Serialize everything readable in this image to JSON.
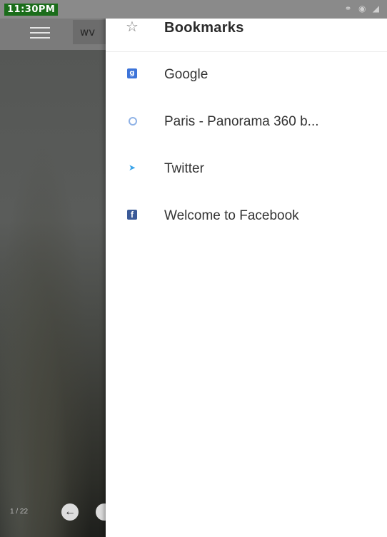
{
  "status_bar": {
    "time": "11:30PM",
    "icons": [
      "headset-icon",
      "wifi-icon",
      "signal-icon"
    ]
  },
  "browser": {
    "url_fragment": "wv",
    "pager_text": "1 / 22"
  },
  "drawer": {
    "title": "Bookmarks",
    "bookmarks": [
      {
        "label": "Google",
        "icon": "google-icon"
      },
      {
        "label": "Paris - Panorama 360 b...",
        "icon": "globe-icon"
      },
      {
        "label": "Twitter",
        "icon": "twitter-icon"
      },
      {
        "label": "Welcome to Facebook",
        "icon": "facebook-icon"
      }
    ]
  },
  "colors": {
    "status_time_bg": "#1b6d1b",
    "google": "#3d74d9",
    "twitter": "#3ba4e9",
    "facebook": "#3b5a98"
  }
}
